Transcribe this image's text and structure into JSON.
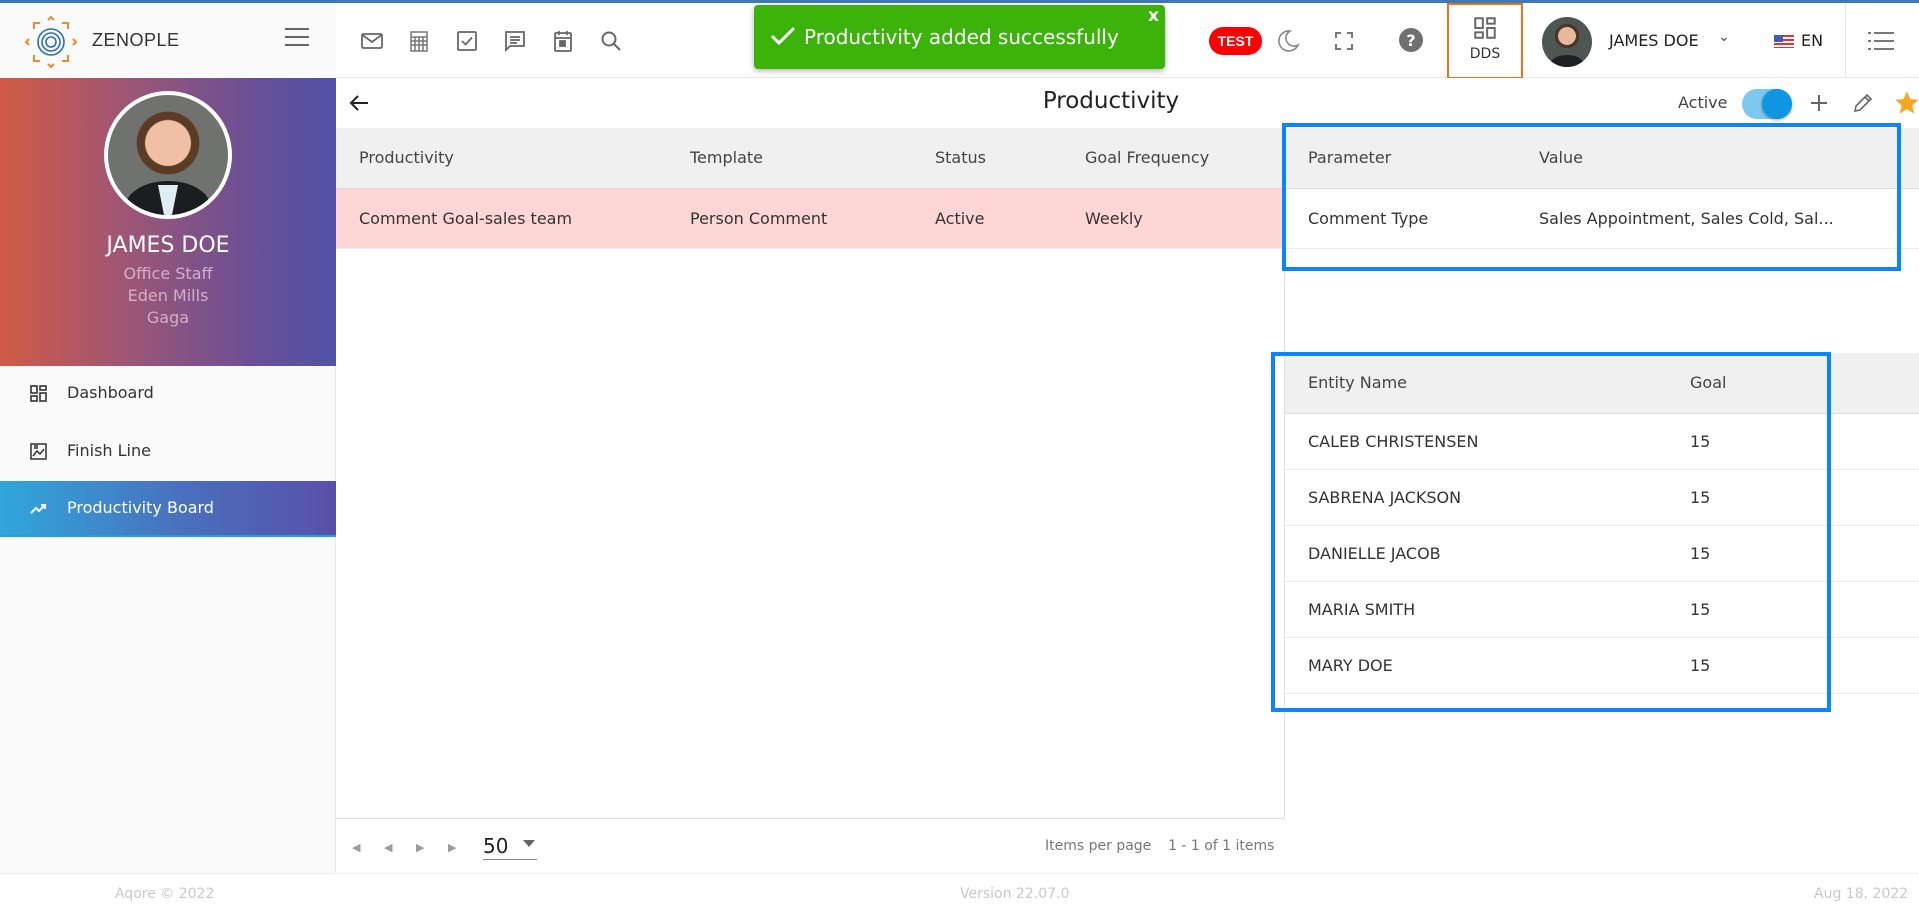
{
  "app": {
    "name": "ZENOPLE"
  },
  "header": {
    "toolbar_icons": [
      "mail-icon",
      "calculator-icon",
      "task-check-icon",
      "message-icon",
      "calendar-icon",
      "search-icon"
    ],
    "toast": {
      "message": "Productivity added successfully",
      "close_label": "x",
      "color": "#3bb30b"
    },
    "env_badge": "TEST",
    "dds_label": "DDS",
    "user_name": "JAMES DOE",
    "language": "EN"
  },
  "sidebar": {
    "profile": {
      "name": "JAMES DOE",
      "role": "Office Staff",
      "location": "Eden Mills",
      "group": "Gaga"
    },
    "items": [
      {
        "label": "Dashboard",
        "icon": "dashboard-icon",
        "active": false
      },
      {
        "label": "Finish Line",
        "icon": "finish-line-icon",
        "active": false
      },
      {
        "label": "Productivity Board",
        "icon": "trending-up-icon",
        "active": true
      }
    ]
  },
  "page": {
    "title": "Productivity",
    "status_label": "Active",
    "status_on": true
  },
  "productivity_table": {
    "columns": [
      "Productivity",
      "Template",
      "Status",
      "Goal Frequency"
    ],
    "rows": [
      [
        "Comment Goal-sales team",
        "Person Comment",
        "Active",
        "Weekly"
      ]
    ]
  },
  "parameter_table": {
    "columns": [
      "Parameter",
      "Value"
    ],
    "rows": [
      [
        "Comment Type",
        "Sales Appointment, Sales Cold, Sal..."
      ]
    ]
  },
  "entity_table": {
    "columns": [
      "Entity Name",
      "Goal"
    ],
    "rows": [
      [
        "CALEB CHRISTENSEN",
        "15"
      ],
      [
        "SABRENA JACKSON",
        "15"
      ],
      [
        "DANIELLE JACOB",
        "15"
      ],
      [
        "MARIA SMITH",
        "15"
      ],
      [
        "MARY DOE",
        "15"
      ]
    ]
  },
  "pager": {
    "page_size": "50",
    "items_per_page_label": "Items per page",
    "range_label": "1 - 1 of 1 items"
  },
  "footer": {
    "copyright": "Aqore © 2022",
    "version": "Version 22.07.0",
    "date": "Aug 18, 2022"
  }
}
